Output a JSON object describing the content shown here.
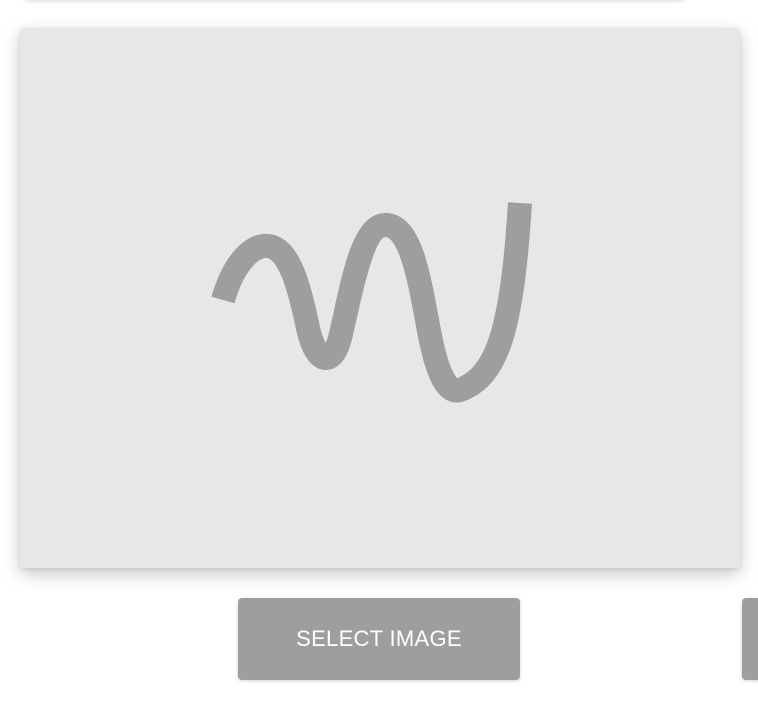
{
  "image_placeholder": {
    "icon": "squiggle-placeholder-icon",
    "background_color": "#e7e7e7",
    "icon_color": "#9e9e9e"
  },
  "buttons": {
    "select_image_label": "SELECT IMAGE",
    "button_color": "#9e9e9e",
    "label_color": "#ffffff"
  }
}
